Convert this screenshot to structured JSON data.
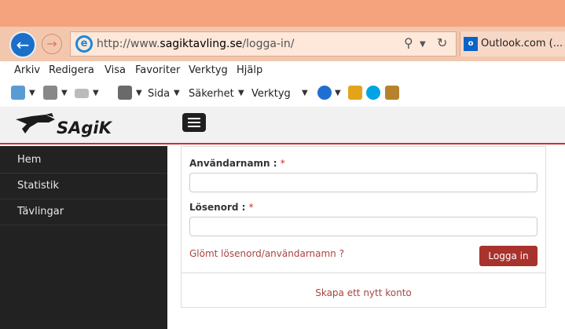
{
  "browser": {
    "url_prefix": "http://www.",
    "url_domain": "sagiktavling.se",
    "url_path": "/logga-in/",
    "tab_title": "Outlook.com (...",
    "tab_icon_text": "o",
    "menu": [
      "Arkiv",
      "Redigera",
      "Visa",
      "Favoriter",
      "Verktyg",
      "Hjälp"
    ],
    "commands": {
      "sida": "Sida",
      "sakerhet": "Säkerhet",
      "verktyg": "Verktyg"
    }
  },
  "site": {
    "logo_text": "SAgiK",
    "sidebar": [
      {
        "label": "Hem"
      },
      {
        "label": "Statistik"
      },
      {
        "label": "Tävlingar"
      }
    ]
  },
  "login": {
    "username_label": "Användarnamn :",
    "password_label": "Lösenord :",
    "required_mark": "*",
    "username_value": "",
    "password_value": "",
    "forgot_link": "Glömt lösenord/användarnamn ?",
    "login_button": "Logga in",
    "create_account": "Skapa ett nytt konto"
  },
  "colors": {
    "accent_red": "#a8322c",
    "link_red": "#a94442",
    "sidebar_bg": "#222222",
    "browser_chrome": "#f2c7ae"
  }
}
